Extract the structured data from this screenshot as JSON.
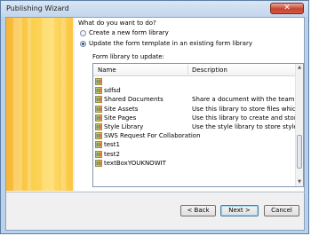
{
  "window": {
    "title": "Publishing Wizard",
    "close_glyph": "✕"
  },
  "question": "What do you want to do?",
  "options": [
    {
      "label": "Create a new form library",
      "selected": false
    },
    {
      "label": "Update the form template in an existing form library",
      "selected": true
    }
  ],
  "library_group": {
    "label": "Form library to update:",
    "columns": {
      "name": "Name",
      "description": "Description"
    },
    "rows": [
      {
        "name": "",
        "description": ""
      },
      {
        "name": "sdfsd",
        "description": ""
      },
      {
        "name": "Shared Documents",
        "description": "Share a document with the team b..."
      },
      {
        "name": "Site Assets",
        "description": "Use this library to store files which..."
      },
      {
        "name": "Site Pages",
        "description": "Use this library to create and stor..."
      },
      {
        "name": "Style Library",
        "description": "Use the style library to store style..."
      },
      {
        "name": "SWS Request For Collaboration",
        "description": ""
      },
      {
        "name": "test1",
        "description": ""
      },
      {
        "name": "test2",
        "description": ""
      },
      {
        "name": "textBoxYOUKNOWIT",
        "description": ""
      }
    ],
    "row_icon": "document-library-icon"
  },
  "buttons": {
    "back": "< Back",
    "next": "Next >",
    "cancel": "Cancel"
  },
  "colors": {
    "banner": "#f9c440",
    "accent": "#3c7fb1"
  }
}
